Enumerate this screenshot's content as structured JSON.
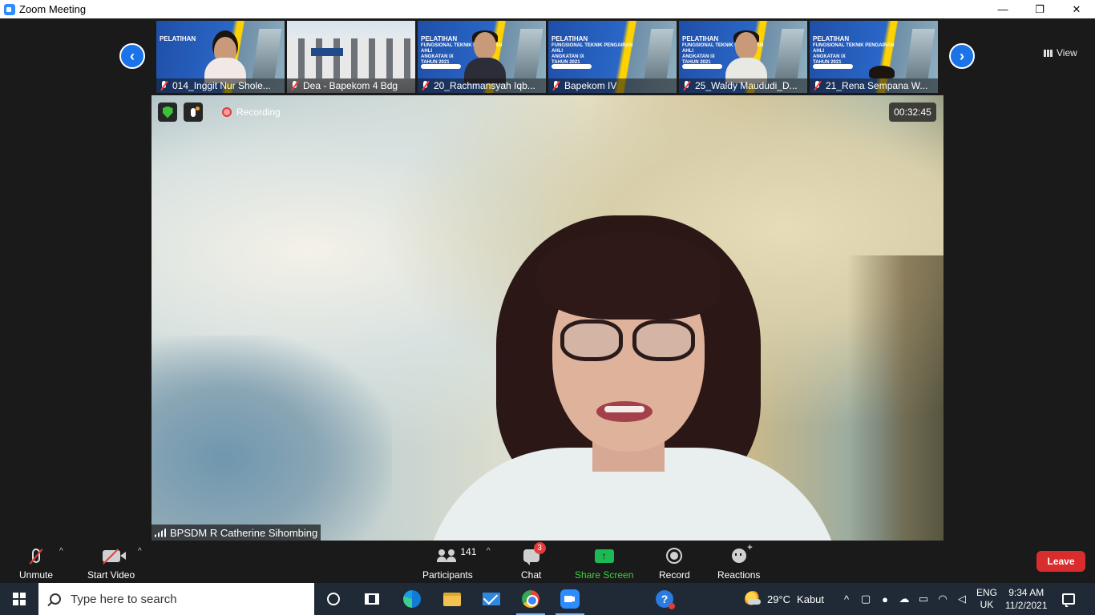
{
  "window": {
    "title": "Zoom Meeting",
    "controls": {
      "minimize": "—",
      "restore": "❐",
      "close": "✕"
    }
  },
  "gallery": {
    "prev_arrow": "‹",
    "next_arrow": "›",
    "view_label": "View",
    "thumbnails": [
      {
        "name": "014_Inggit Nur Shole...",
        "muted": true
      },
      {
        "name": "Dea - Bapekom 4 Bdg",
        "muted": true
      },
      {
        "name": "20_Rachmansyah Iqb...",
        "muted": true
      },
      {
        "name": "Bapekom IV",
        "muted": true
      },
      {
        "name": "25_Waldy Maududi_D...",
        "muted": true
      },
      {
        "name": "21_Rena Sempana W...",
        "muted": true
      }
    ],
    "banner": {
      "line1": "PELATIHAN",
      "line2": "FUNGSIONAL TEKNIK PENGAIRAN AHLI",
      "line3": "ANGKATAN IX",
      "line4": "TAHUN 2021"
    }
  },
  "main_video": {
    "recording_label": "Recording",
    "timer": "00:32:45",
    "speaker_name": "BPSDM R Catherine Sihombing"
  },
  "toolbar": {
    "unmute_label": "Unmute",
    "start_video_label": "Start Video",
    "participants_label": "Participants",
    "participants_count": "141",
    "chat_label": "Chat",
    "chat_badge": "3",
    "share_label": "Share Screen",
    "share_arrow": "↑",
    "record_label": "Record",
    "reactions_label": "Reactions",
    "leave_label": "Leave",
    "caret": "^"
  },
  "taskbar": {
    "search_placeholder": "Type here to search",
    "help_glyph": "?",
    "weather_temp": "29°C",
    "weather_desc": "Kabut",
    "chevron": "^",
    "lang_top": "ENG",
    "lang_bottom": "UK",
    "time": "9:34 AM",
    "date": "11/2/2021"
  },
  "colors": {
    "accent_blue": "#1a73e8",
    "share_green": "#1db954",
    "leave_red": "#d92d2d",
    "taskbar": "#1f2a36"
  }
}
